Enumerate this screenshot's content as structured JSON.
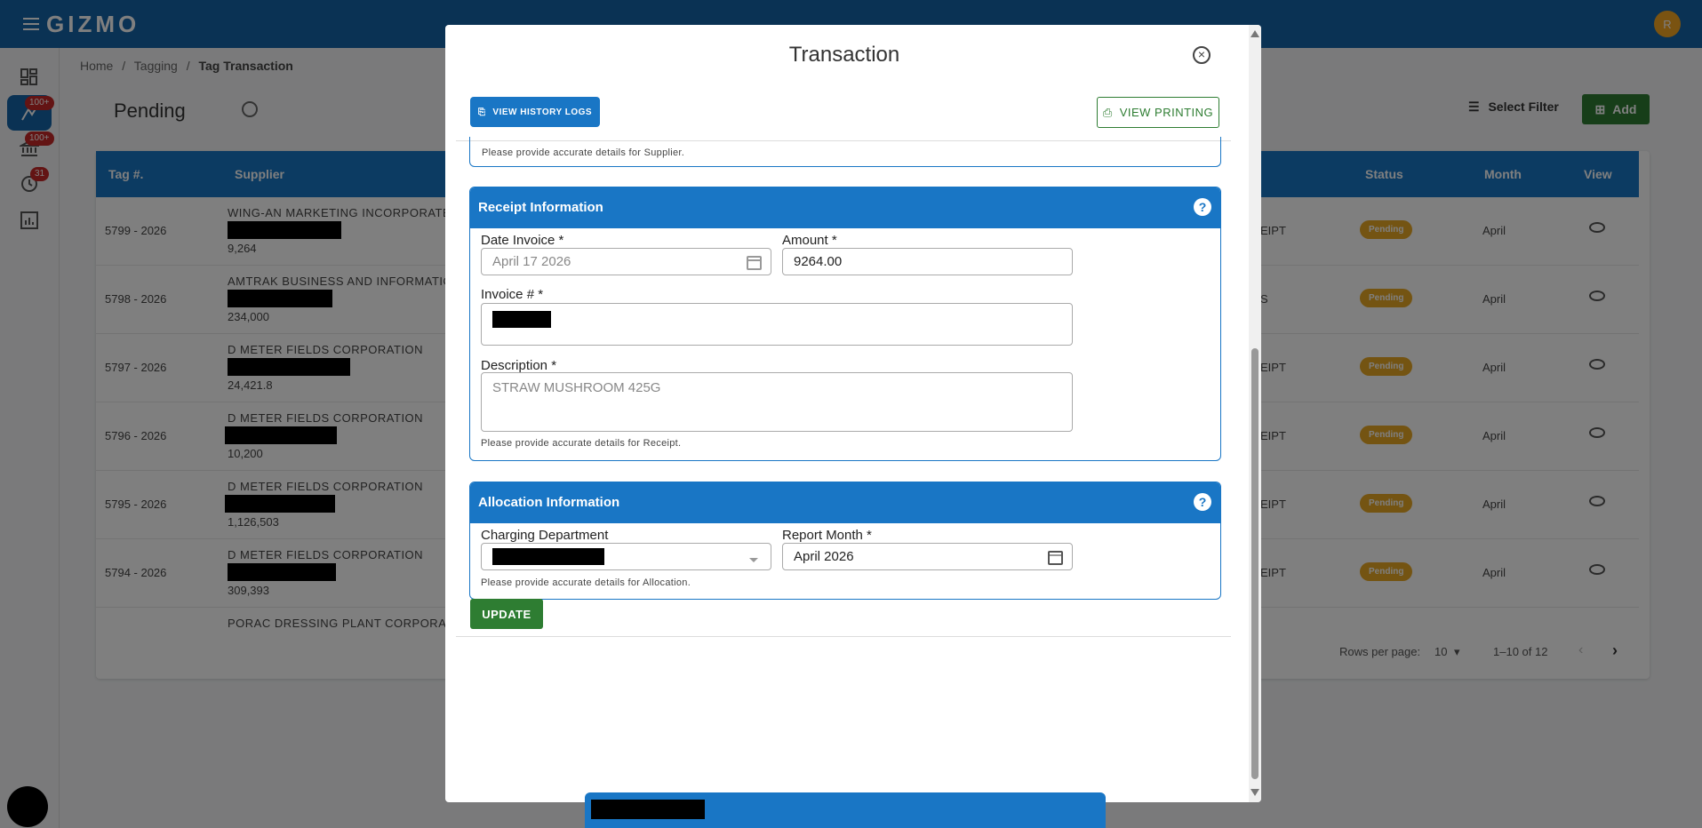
{
  "app": {
    "brand": "GIZMO",
    "user_initial": "R"
  },
  "nav": {
    "badges": [
      "100+",
      "100+",
      "31"
    ]
  },
  "breadcrumb": {
    "home": "Home",
    "sep1": "/",
    "tagging": "Tagging",
    "sep2": "/",
    "current": "Tag Transaction"
  },
  "page": {
    "status_title": "Pending",
    "select_filter": "Select Filter",
    "add_label": "Add"
  },
  "table": {
    "headers": {
      "tag": "Tag #.",
      "supplier": "Supplier",
      "status": "Status",
      "month": "Month",
      "view": "View"
    },
    "rows": [
      {
        "tag": "5799 - 2026",
        "supplier": "WING-AN MARKETING INCORPORATED",
        "amount": "9,264",
        "receipt": "EIPT",
        "status": "Pending",
        "month": "April"
      },
      {
        "tag": "5798 - 2026",
        "supplier": "AMTRAK BUSINESS AND INFORMATION",
        "amount": "234,000",
        "receipt": "S",
        "status": "Pending",
        "month": "April"
      },
      {
        "tag": "5797 - 2026",
        "supplier": "D METER FIELDS CORPORATION",
        "amount": "24,421.8",
        "receipt": "EIPT",
        "status": "Pending",
        "month": "April"
      },
      {
        "tag": "5796 - 2026",
        "supplier": "D METER FIELDS CORPORATION",
        "amount": "10,200",
        "receipt": "EIPT",
        "status": "Pending",
        "month": "April"
      },
      {
        "tag": "5795 - 2026",
        "supplier": "D METER FIELDS CORPORATION",
        "amount": "1,126,503",
        "receipt": "EIPT",
        "status": "Pending",
        "month": "April"
      },
      {
        "tag": "5794 - 2026",
        "supplier": "D METER FIELDS CORPORATION",
        "amount": "309,393",
        "receipt": "EIPT",
        "status": "Pending",
        "month": "April"
      },
      {
        "tag": "",
        "supplier": "PORAC DRESSING PLANT CORPORATION",
        "amount": "",
        "receipt": "",
        "status": "",
        "month": ""
      }
    ],
    "pagination": {
      "rows_per_page_label": "Rows per page:",
      "rows_per_page": "10",
      "range": "1–10 of 12"
    }
  },
  "modal": {
    "title": "Transaction",
    "history_button": "VIEW HISTORY LOGS",
    "printing_button": "VIEW PRINTING",
    "supplier_help": "Please provide accurate details for Supplier.",
    "receipt": {
      "title": "Receipt Information",
      "date_label": "Date Invoice *",
      "date_value": "April 17 2026",
      "amount_label": "Amount *",
      "amount_value": "9264.00",
      "invoice_label": "Invoice # *",
      "description_label": "Description *",
      "description_value": "STRAW MUSHROOM 425G",
      "help": "Please provide accurate details for Receipt."
    },
    "allocation": {
      "title": "Allocation Information",
      "department_label": "Charging Department",
      "report_month_label": "Report Month *",
      "report_month_value": "April 2026",
      "help": "Please provide accurate details for Allocation."
    },
    "update_button": "UPDATE"
  },
  "colors": {
    "primary": "#1976c5",
    "topbar": "#1565a8",
    "success": "#2e7d32",
    "pending": "#e69a00",
    "badge": "#c62828"
  }
}
